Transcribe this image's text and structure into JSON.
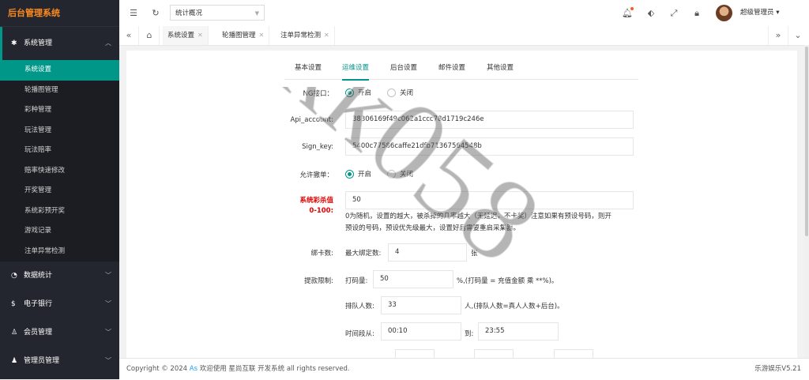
{
  "sidebar": {
    "logo": "后台管理系统",
    "groups": [
      {
        "label": "系统管理",
        "icon": "gear-icon"
      },
      {
        "label": "数据统计",
        "icon": "dashboard-icon"
      },
      {
        "label": "电子银行",
        "icon": "money-icon"
      },
      {
        "label": "会员管理",
        "icon": "users-icon"
      },
      {
        "label": "管理员管理",
        "icon": "user-icon"
      }
    ],
    "items": [
      "系统设置",
      "轮播图管理",
      "彩种管理",
      "玩法管理",
      "玩法赔率",
      "赔率快速修改",
      "开奖管理",
      "系统彩预开奖",
      "游戏记录",
      "注单异常检测"
    ]
  },
  "header": {
    "select_value": "统计概况",
    "username": "超级管理员"
  },
  "tabs": [
    "系统设置",
    "轮播图管理",
    "注单异常检测"
  ],
  "content_tabs": [
    "基本设置",
    "运维设置",
    "后台设置",
    "邮件设置",
    "其他设置"
  ],
  "form": {
    "ng_label": "NG接口：",
    "ng_on": "开启",
    "ng_off": "关闭",
    "api_label": "Api_account:",
    "api_value": "38306169f49c062a1ccc78d1719c246e",
    "sign_label": "Sign_key:",
    "sign_value": "5400c77586caffe21dfb71367564548b",
    "cancel_label": "允许撤单：",
    "cancel_on": "开启",
    "cancel_off": "关闭",
    "kill_label_1": "系统彩杀值",
    "kill_label_2": "0-100:",
    "kill_value": "50",
    "kill_help": "0为随机，设置的越大，被杀掉的几率越大（无延迟，不卡奖）注意如果有预设号码，则开预设的号码，预设优先级最大，设置好后需要重启采集器。",
    "card_label": "绑卡数:",
    "card_max_label": "最大绑定数:",
    "card_max_value": "4",
    "card_unit": "张",
    "withdraw_label": "提款限制:",
    "bet_label": "打码量:",
    "bet_value": "50",
    "bet_suffix": "%,(打码量 = 充值金额 乘 **%)。",
    "queue_label": "排队人数:",
    "queue_value": "33",
    "queue_suffix": "人,(排队人数=真人人数+后台)。",
    "time_label": "时间段从:",
    "time_from": "00:10",
    "time_to_label": "到:",
    "time_to": "23:55"
  },
  "footer": {
    "copyright": "Copyright © 2024",
    "link": "As",
    "text": "欢迎使用 星尚互联 开发系统 all rights reserved.",
    "version": "乐游娱乐V5.21"
  },
  "watermark": "kk058"
}
